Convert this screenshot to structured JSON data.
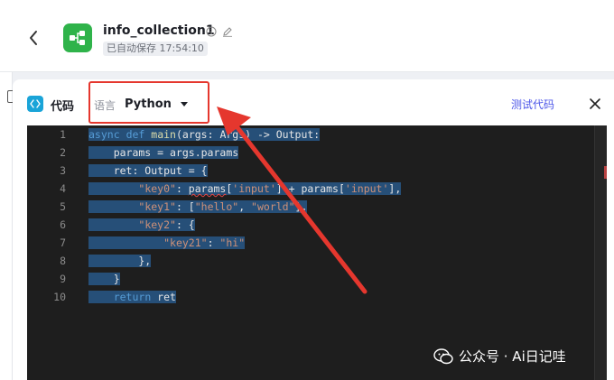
{
  "header": {
    "app_title": "info_collection1",
    "save_status": "已自动保存 17:54:10"
  },
  "panel": {
    "title": "代码",
    "language_label": "语言",
    "language_value": "Python",
    "test_link": "测试代码"
  },
  "editor": {
    "line_numbers": [
      "1",
      "2",
      "3",
      "4",
      "5",
      "6",
      "7",
      "8",
      "9",
      "10"
    ],
    "lines": [
      "async def main(args: Args) -> Output:",
      "    params = args.params",
      "    ret: Output = {",
      "        \"key0\": params['input'] + params['input'],",
      "        \"key1\": [\"hello\", \"world\"],",
      "        \"key2\": {",
      "            \"key21\": \"hi\"",
      "        },",
      "    }",
      "    return ret"
    ]
  },
  "watermark": {
    "text": "公众号 · Ai日记哇"
  },
  "colors": {
    "accent_link": "#4b55e8",
    "annotation_red": "#e5372e",
    "logo_green": "#2fb34a",
    "editor_bg": "#1e1e1e",
    "selection": "#264f78"
  },
  "icons": [
    "chevron-left-icon",
    "flow-icon",
    "info-icon",
    "edit-icon",
    "code-icon",
    "caret-down-icon",
    "close-icon",
    "wechat-icon"
  ]
}
